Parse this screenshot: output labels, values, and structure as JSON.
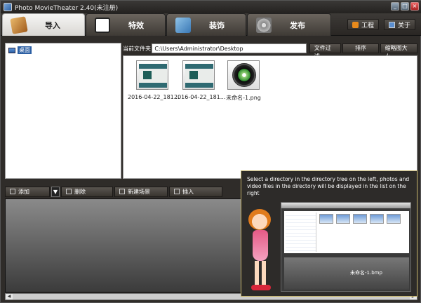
{
  "window": {
    "title": "Photo MovieTheater 2.40(未注册)",
    "minimize": "_",
    "maximize": "□",
    "close": "×"
  },
  "tabs": [
    {
      "label": "导入",
      "active": true
    },
    {
      "label": "特效",
      "active": false
    },
    {
      "label": "装饰",
      "active": false
    },
    {
      "label": "发布",
      "active": false
    }
  ],
  "side_buttons": {
    "project": "工程",
    "about": "关于"
  },
  "tree": {
    "items": [
      {
        "label": "桌面"
      }
    ]
  },
  "pathbar": {
    "label": "当前文件夹",
    "path": "C:\\Users\\Administrator\\Desktop",
    "filter": "文件过滤",
    "sort": "排序",
    "thumb_size": "缩略图大小"
  },
  "files": [
    {
      "name": "2016-04-22_181...",
      "kind": "screenshot"
    },
    {
      "name": "2016-04-22_181...",
      "kind": "screenshot"
    },
    {
      "name": "未命名-1.png",
      "kind": "cd-image"
    }
  ],
  "bottom_toolbar": {
    "add": "添加",
    "dropdown": "▼",
    "delete": "删除",
    "new_scene": "新建场景",
    "insert": "插入"
  },
  "help": {
    "text": "Select a directory in the directory tree on the left, photos and video files in the directory will be displayed in the list on the right",
    "mini_caption": "未命名-1.bmp"
  },
  "scroll": {
    "left": "◀",
    "right": "▶"
  }
}
